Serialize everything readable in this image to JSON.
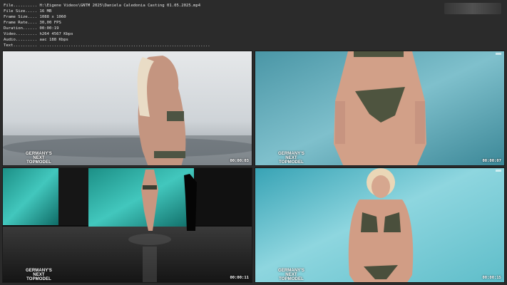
{
  "info": {
    "file": "File.......... H:\\Eigene Videos\\GNTM 2025\\Daniela Caledonia Casting 01.05.2025.mp4",
    "size": "File Size..... 16 MB",
    "frame_size": "Frame Size.... 1088 x 1060",
    "frame_rate": "Frame Rate.... 30,00 FPS",
    "duration": "Duration...... 00:00:19",
    "video": "Video......... h264 4567 Kbps",
    "audio": "Audio......... aac 188 Kbps",
    "text": "Text.......... ......................................................................."
  },
  "thumbnails": [
    {
      "timestamp": "00:00:03",
      "brand": [
        "GERMANY'S",
        "NEXT",
        "TOPMODEL"
      ]
    },
    {
      "timestamp": "00:00:07",
      "brand": [
        "GERMANY'S",
        "NEXT",
        "TOPMODEL"
      ]
    },
    {
      "timestamp": "00:00:11",
      "brand": [
        "GERMANY'S",
        "NEXT",
        "TOPMODEL"
      ]
    },
    {
      "timestamp": "00:00:15",
      "brand": [
        "GERMANY'S",
        "NEXT",
        "TOPMODEL"
      ]
    }
  ]
}
